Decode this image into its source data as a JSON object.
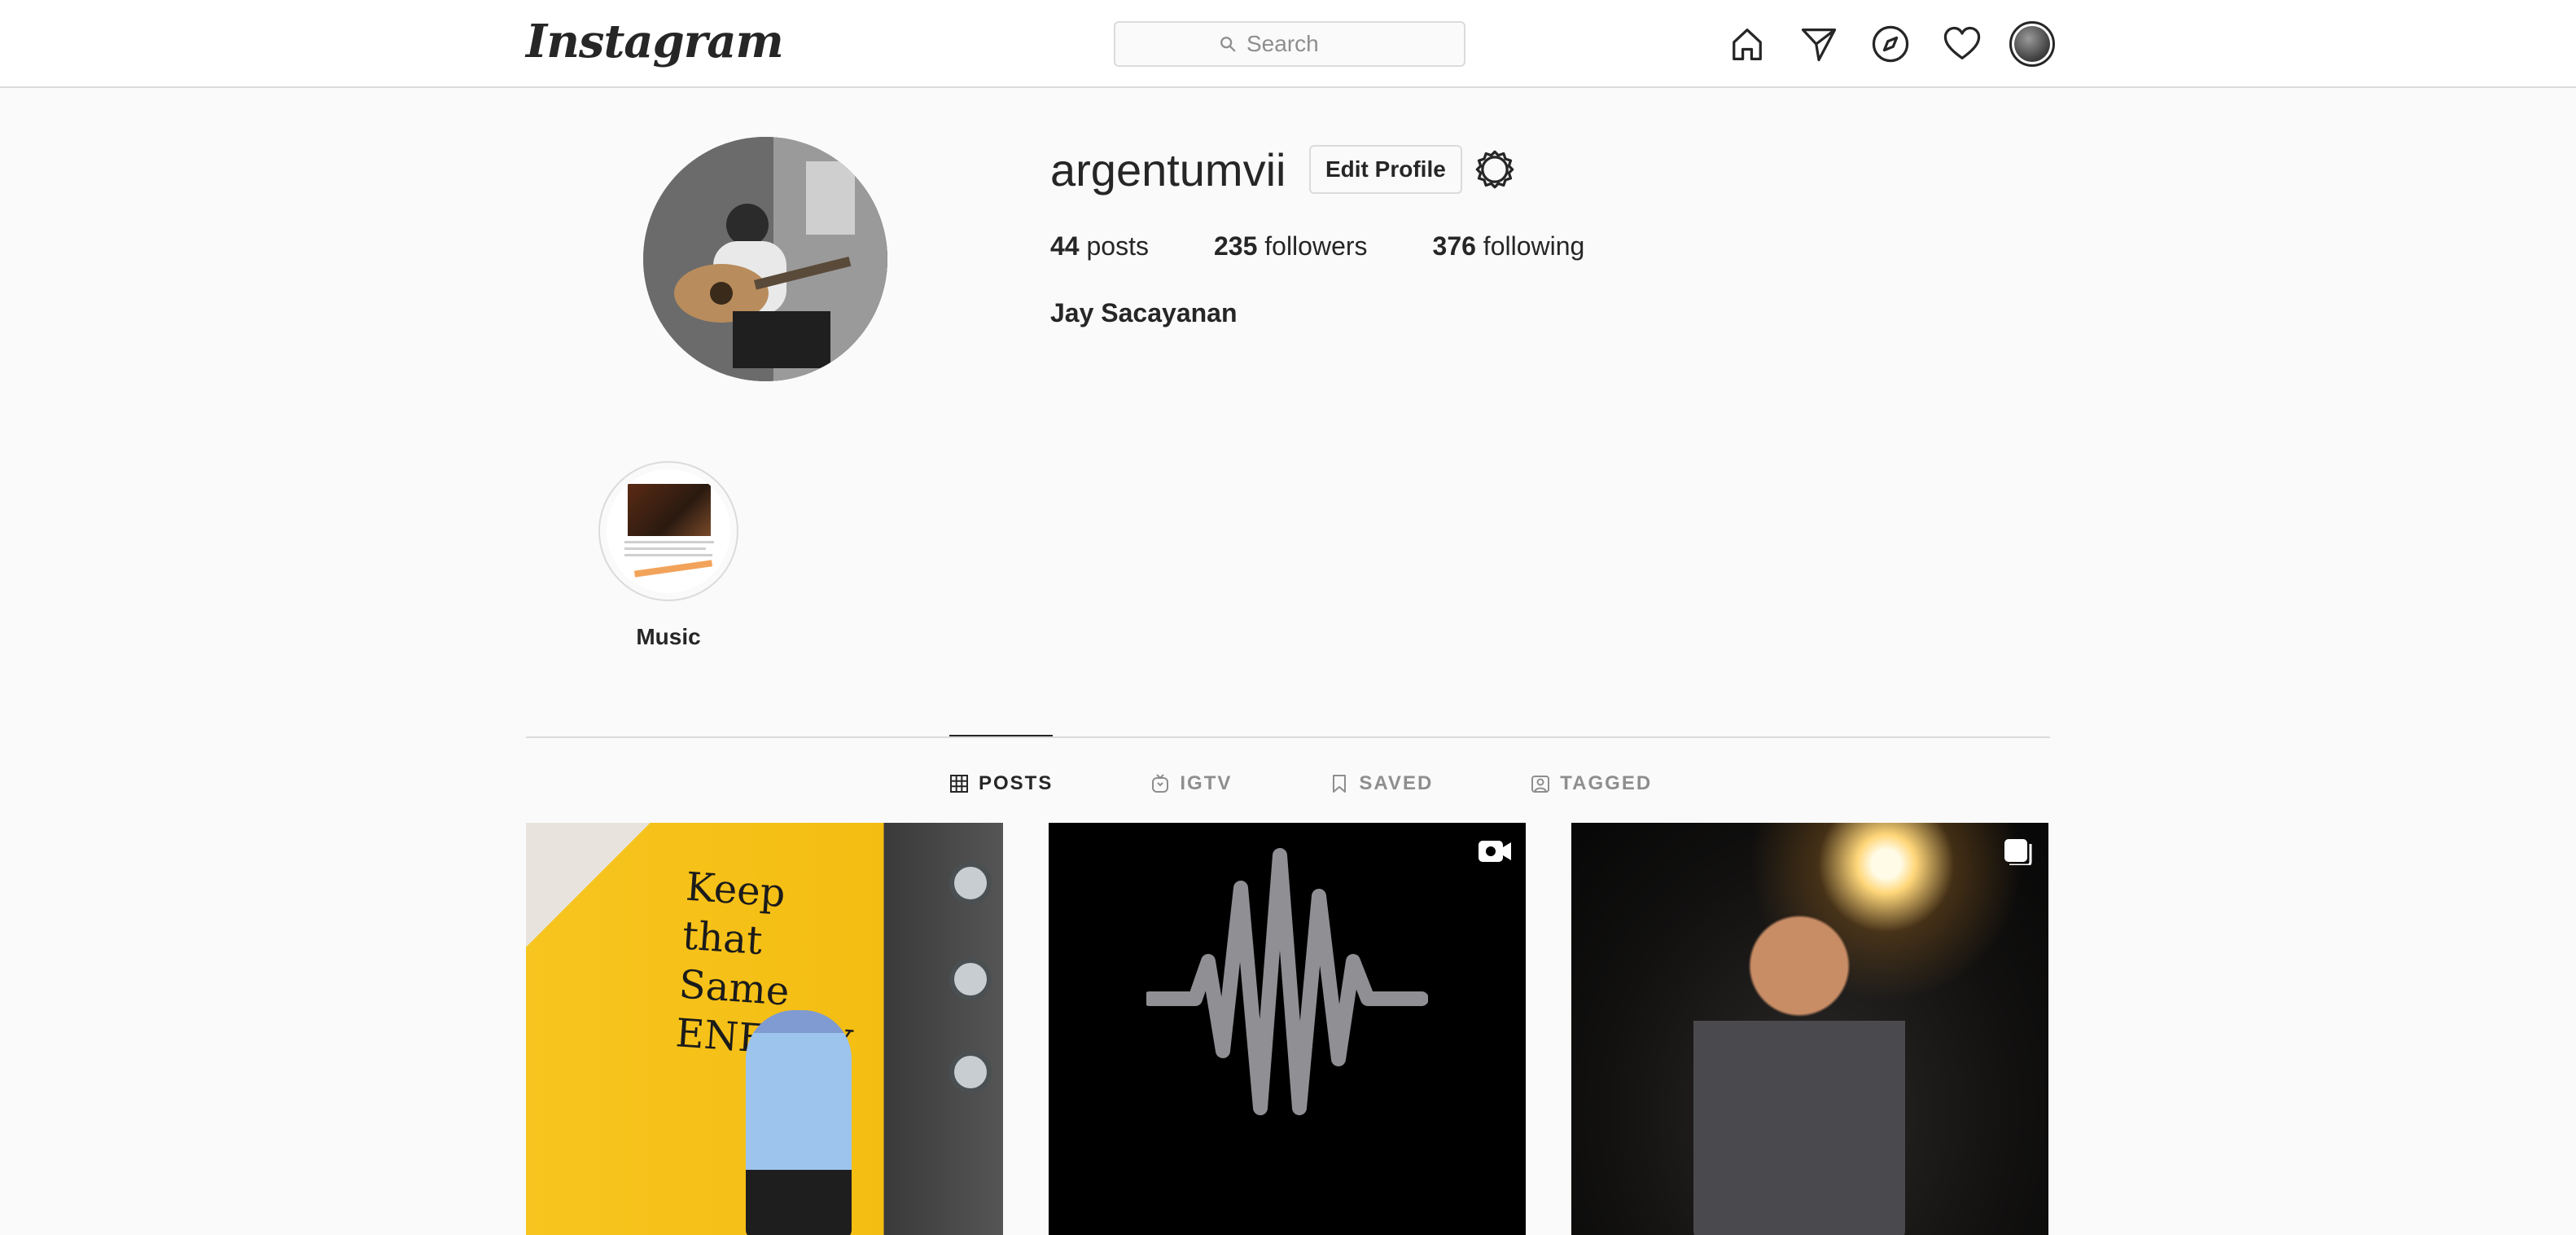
{
  "nav": {
    "logo": "Instagram",
    "search_placeholder": "Search",
    "icons": [
      "home-icon",
      "direct-icon",
      "explore-icon",
      "activity-icon",
      "profile-avatar"
    ]
  },
  "profile": {
    "username": "argentumvii",
    "edit_label": "Edit Profile",
    "stats": [
      {
        "count": "44",
        "label": "posts"
      },
      {
        "count": "235",
        "label": "followers"
      },
      {
        "count": "376",
        "label": "following"
      }
    ],
    "full_name": "Jay Sacayanan"
  },
  "highlights": [
    {
      "label": "Music"
    }
  ],
  "tabs": [
    {
      "label": "POSTS",
      "icon": "grid-icon",
      "active": true
    },
    {
      "label": "IGTV",
      "icon": "igtv-icon",
      "active": false
    },
    {
      "label": "SAVED",
      "icon": "bookmark-icon",
      "active": false
    },
    {
      "label": "TAGGED",
      "icon": "tag-icon",
      "active": false
    }
  ],
  "posts": [
    {
      "type": "photo",
      "wall_text": "Keep that Same ENERGY"
    },
    {
      "type": "video",
      "badge": "video-icon"
    },
    {
      "type": "carousel",
      "badge": "carousel-icon"
    }
  ],
  "colors": {
    "background": "#fafafa",
    "border": "#dbdbdb",
    "text": "#262626",
    "muted": "#8e8e8e"
  }
}
